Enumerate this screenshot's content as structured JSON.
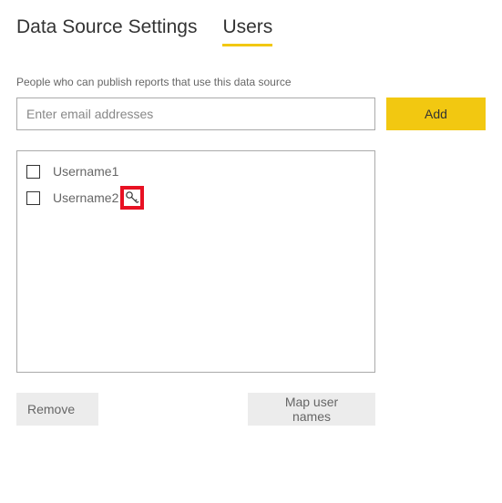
{
  "tabs": {
    "settings": "Data Source Settings",
    "users": "Users"
  },
  "description": "People who can publish reports that use this data source",
  "emailInput": {
    "placeholder": "Enter email addresses"
  },
  "buttons": {
    "add": "Add",
    "remove": "Remove",
    "map": "Map user names"
  },
  "users": [
    {
      "name": "Username1",
      "admin": false
    },
    {
      "name": "Username2",
      "admin": true
    }
  ]
}
